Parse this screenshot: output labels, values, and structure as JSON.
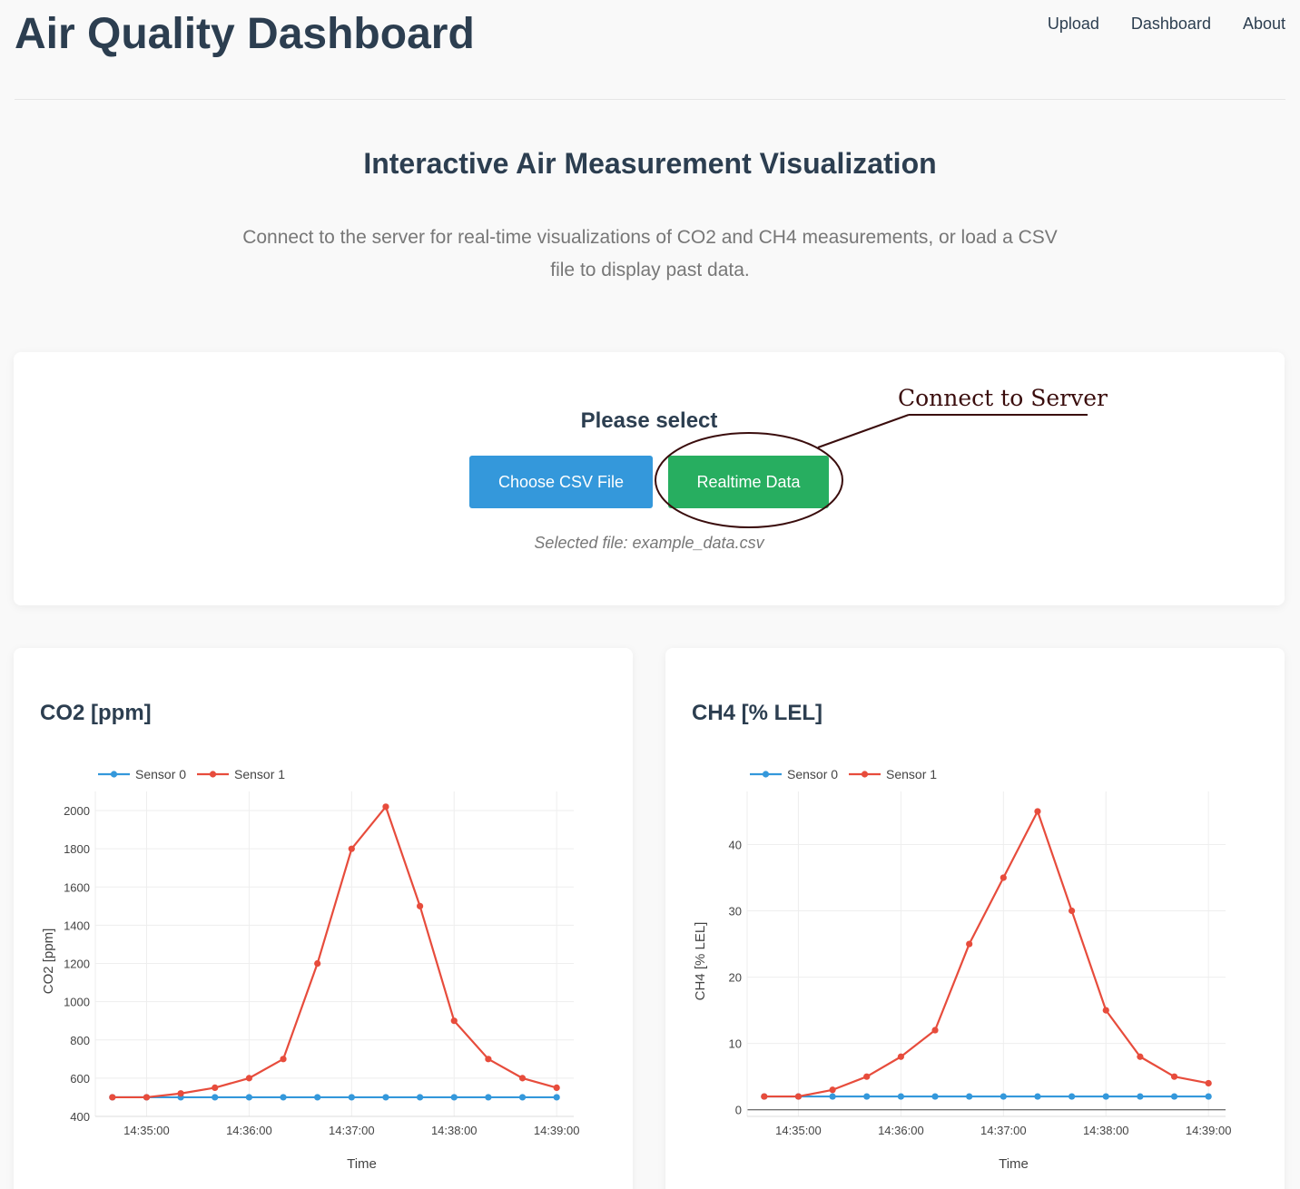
{
  "header": {
    "title": "Air Quality Dashboard",
    "nav": [
      "Upload",
      "Dashboard",
      "About"
    ]
  },
  "intro": {
    "title": "Interactive Air Measurement Visualization",
    "text": "Connect to the server for real-time visualizations of CO2 and CH4 measurements, or load a CSV file to display past data."
  },
  "select": {
    "title": "Please select",
    "csv_button": "Choose CSV File",
    "realtime_button": "Realtime Data",
    "selected_file": "Selected file: example_data.csv",
    "annotation": "Connect to Server"
  },
  "colors": {
    "sensor0": "#3498db",
    "sensor1": "#e74c3c",
    "csv_button": "#3498db",
    "realtime_button": "#27ae60",
    "annotation": "#3a0d0d"
  },
  "chart_data": [
    {
      "type": "line",
      "title": "CO2 [ppm]",
      "xlabel": "Time",
      "ylabel": "CO2 [ppm]",
      "ylim": [
        400,
        2100
      ],
      "yticks": [
        400,
        600,
        800,
        1000,
        1200,
        1400,
        1600,
        1800,
        2000
      ],
      "xticks": [
        "14:35:00",
        "14:36:00",
        "14:37:00",
        "14:38:00",
        "14:39:00"
      ],
      "x": [
        "14:34:40",
        "14:35:00",
        "14:35:20",
        "14:35:40",
        "14:36:00",
        "14:36:20",
        "14:36:40",
        "14:37:00",
        "14:37:20",
        "14:37:40",
        "14:38:00",
        "14:38:20",
        "14:38:40",
        "14:39:00"
      ],
      "legend": "top-left",
      "grid": true,
      "series": [
        {
          "name": "Sensor 0",
          "values": [
            500,
            500,
            500,
            500,
            500,
            500,
            500,
            500,
            500,
            500,
            500,
            500,
            500,
            500
          ]
        },
        {
          "name": "Sensor 1",
          "values": [
            500,
            500,
            520,
            550,
            600,
            700,
            1200,
            1800,
            2020,
            1500,
            900,
            700,
            600,
            550
          ]
        }
      ]
    },
    {
      "type": "line",
      "title": "CH4 [% LEL]",
      "xlabel": "Time",
      "ylabel": "CH4 [% LEL]",
      "ylim": [
        -1,
        48
      ],
      "yticks": [
        0,
        10,
        20,
        30,
        40
      ],
      "xticks": [
        "14:35:00",
        "14:36:00",
        "14:37:00",
        "14:38:00",
        "14:39:00"
      ],
      "x": [
        "14:34:40",
        "14:35:00",
        "14:35:20",
        "14:35:40",
        "14:36:00",
        "14:36:20",
        "14:36:40",
        "14:37:00",
        "14:37:20",
        "14:37:40",
        "14:38:00",
        "14:38:20",
        "14:38:40",
        "14:39:00"
      ],
      "legend": "top-left",
      "grid": true,
      "series": [
        {
          "name": "Sensor 0",
          "values": [
            2,
            2,
            2,
            2,
            2,
            2,
            2,
            2,
            2,
            2,
            2,
            2,
            2,
            2
          ]
        },
        {
          "name": "Sensor 1",
          "values": [
            2,
            2,
            3,
            5,
            8,
            12,
            25,
            35,
            45,
            30,
            15,
            8,
            5,
            4
          ]
        }
      ]
    }
  ]
}
